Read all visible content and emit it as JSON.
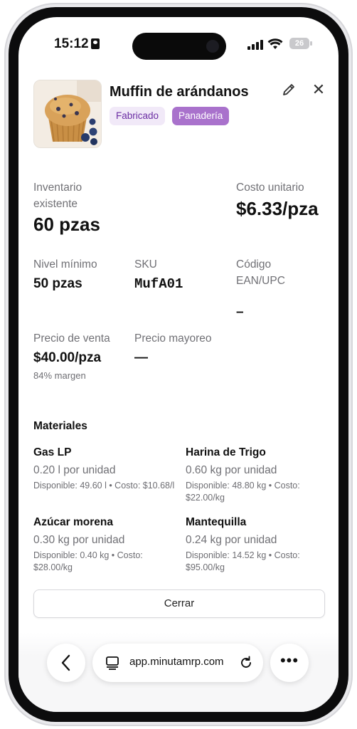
{
  "status_bar": {
    "time": "15:12",
    "battery": "26"
  },
  "product": {
    "name": "Muffin de arándanos",
    "tags": [
      "Fabricado",
      "Panadería"
    ],
    "image_alt": "muffin-photo"
  },
  "stats": {
    "inventory_label": "Inventario existente",
    "inventory_value": "60 pzas",
    "unit_cost_label": "Costo unitario",
    "unit_cost_value": "$6.33/pza",
    "min_level_label": "Nivel mínimo",
    "min_level_value": "50 pzas",
    "sku_label": "SKU",
    "sku_value": "MufA01",
    "code_label": "Código EAN/UPC",
    "code_value": "–",
    "sale_price_label": "Precio de venta",
    "sale_price_value": "$40.00/pza",
    "margin_text": "84% margen",
    "wholesale_label": "Precio mayoreo",
    "wholesale_value": "—"
  },
  "materials": {
    "title": "Materiales",
    "items": [
      {
        "name": "Gas LP",
        "qty": "0.20 l por unidad",
        "detail": "Disponible: 49.60 l • Costo: $10.68/l"
      },
      {
        "name": "Harina de Trigo",
        "qty": "0.60 kg por unidad",
        "detail": "Disponible: 48.80 kg • Costo: $22.00/kg"
      },
      {
        "name": "Azúcar morena",
        "qty": "0.30 kg por unidad",
        "detail": "Disponible: 0.40 kg • Costo: $28.00/kg"
      },
      {
        "name": "Mantequilla",
        "qty": "0.24 kg por unidad",
        "detail": "Disponible: 14.52 kg • Costo: $95.00/kg"
      }
    ]
  },
  "actions": {
    "close_label": "Cerrar"
  },
  "browser": {
    "url": "app.minutamrp.com",
    "more": "•••"
  },
  "icons": {
    "edit": "pencil-icon",
    "close": "close-icon",
    "back": "chevron-left-icon",
    "tabs": "tabs-icon",
    "reload": "reload-icon"
  }
}
